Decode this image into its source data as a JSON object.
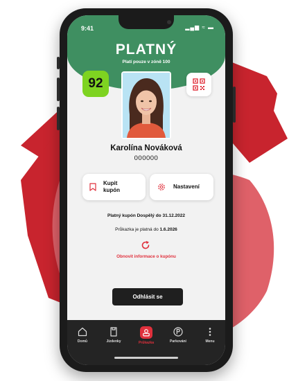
{
  "status_bar": {
    "time": "9:41",
    "icons": "▂▄▆ ≈ ▬"
  },
  "header": {
    "title": "PLATNÝ",
    "subtitle": "Platí pouze v zóně 100"
  },
  "zone_badge": "92",
  "profile": {
    "name": "Karolína Nováková",
    "id": "000000"
  },
  "actions": {
    "buy_label": "Kupit kupón",
    "settings_label": "Nastavení"
  },
  "info": {
    "coupon_text": "Platný kupón Dospělý do 31.12.2022",
    "validity_prefix": "Průkazka je platná do ",
    "validity_date": "1.6.2026",
    "refresh_label": "Obnovit informace o kupónu"
  },
  "logout_label": "Odhlásit se",
  "nav": {
    "items": [
      {
        "label": "Domů",
        "icon": "home-icon"
      },
      {
        "label": "Jízdenky",
        "icon": "ticket-icon"
      },
      {
        "label": "Průkazka",
        "icon": "user-card-icon"
      },
      {
        "label": "Parkování",
        "icon": "parking-icon"
      },
      {
        "label": "Menu",
        "icon": "more-icon"
      }
    ],
    "active_index": 2
  },
  "colors": {
    "green": "#3f8f61",
    "accent_red": "#e0303c",
    "badge_green": "#7ed321"
  }
}
